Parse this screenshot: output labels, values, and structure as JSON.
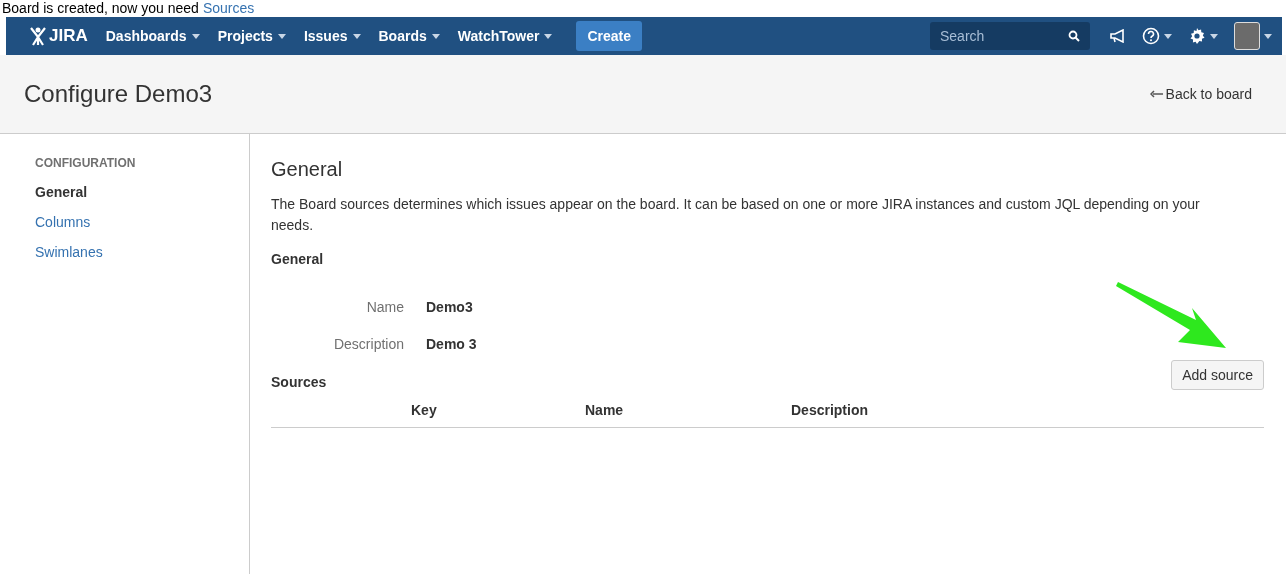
{
  "caption": {
    "text": "Board is created, now you need",
    "link": "Sources"
  },
  "nav": {
    "logo": "JIRA",
    "items": [
      {
        "label": "Dashboards"
      },
      {
        "label": "Projects"
      },
      {
        "label": "Issues"
      },
      {
        "label": "Boards"
      },
      {
        "label": "WatchTower"
      }
    ],
    "create": "Create",
    "search": {
      "placeholder": "Search"
    }
  },
  "header": {
    "title": "Configure Demo3",
    "back": "Back to board"
  },
  "sidebar": {
    "heading": "CONFIGURATION",
    "items": [
      {
        "label": "General",
        "selected": true
      },
      {
        "label": "Columns",
        "selected": false
      },
      {
        "label": "Swimlanes",
        "selected": false
      }
    ]
  },
  "content": {
    "title": "General",
    "description": "The Board sources determines which issues appear on the board. It can be based on one or more JIRA instances and custom JQL depending on your needs.",
    "section": "General",
    "fields": [
      {
        "label": "Name",
        "value": "Demo3"
      },
      {
        "label": "Description",
        "value": "Demo 3"
      }
    ],
    "add_button": "Add source",
    "sources_heading": "Sources",
    "columns": [
      "Key",
      "Name",
      "Description"
    ]
  }
}
